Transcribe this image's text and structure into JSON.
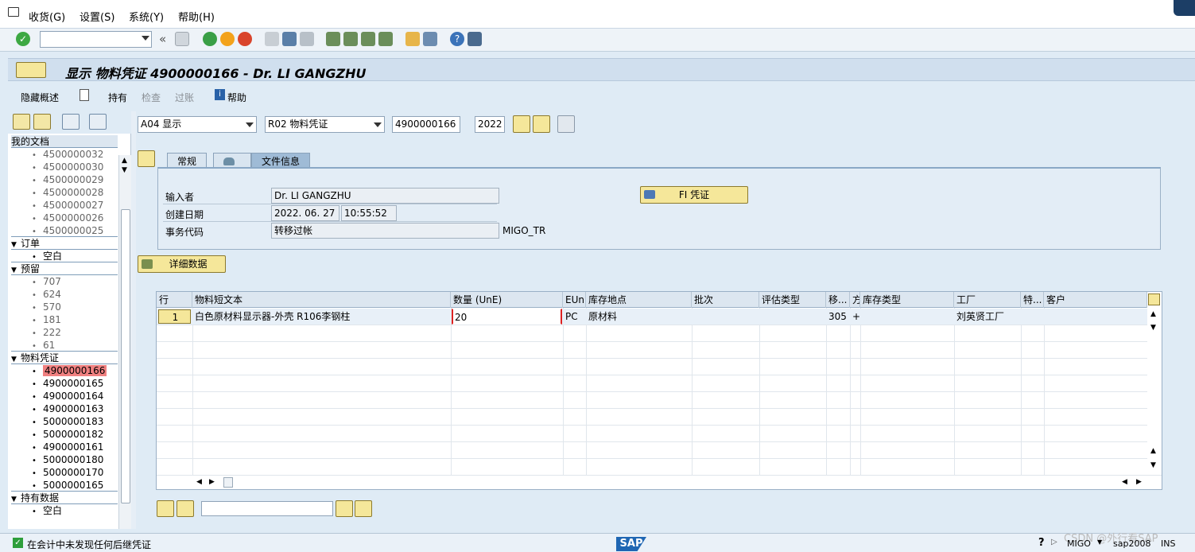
{
  "menu": {
    "items": [
      "收货(G)",
      "设置(S)",
      "系统(Y)",
      "帮助(H)"
    ]
  },
  "toolbar": {
    "command_value": "",
    "back_label": "«"
  },
  "title": "显示 物料凭证 4900000166 - Dr. LI GANGZHU",
  "appbar": {
    "hide_overview": "隐藏概述",
    "hold": "持有",
    "check": "检查",
    "post": "过账",
    "help": "帮助"
  },
  "tree": {
    "header": "我的文档",
    "my_docs": [
      "4500000032",
      "4500000030",
      "4500000029",
      "4500000028",
      "4500000027",
      "4500000026",
      "4500000025"
    ],
    "orders_label": "订单",
    "orders": [
      "空白"
    ],
    "reservations_label": "预留",
    "reservations": [
      "707",
      "624",
      "570",
      "181",
      "222",
      "61"
    ],
    "matdocs_label": "物料凭证",
    "matdocs": [
      "4900000166",
      "4900000165",
      "4900000164",
      "4900000163",
      "5000000183",
      "5000000182",
      "4900000161",
      "5000000180",
      "5000000170",
      "5000000165"
    ],
    "held_label": "持有数据",
    "held": [
      "空白"
    ]
  },
  "header_fields": {
    "action": "A04 显示",
    "ref": "R02 物料凭证",
    "doc_no": "4900000166",
    "year": "2022"
  },
  "tabs": [
    "常规",
    "",
    "文件信息"
  ],
  "docinfo": {
    "entered_by_label": "输入者",
    "entered_by": "Dr. LI GANGZHU",
    "created_label": "创建日期",
    "created_date": "2022. 06. 27",
    "created_time": "10:55:52",
    "tcode_label": "事务代码",
    "tcode": "转移过帐",
    "tcode_code": "MIGO_TR",
    "fi_button": "FI 凭证"
  },
  "detail_button": "详细数据",
  "grid": {
    "columns": [
      "行",
      "物料短文本",
      "数量 (UnE)",
      "EUn",
      "库存地点",
      "批次",
      "评估类型",
      "移...",
      "方",
      "库存类型",
      "工厂",
      "特...",
      "客户"
    ],
    "rows": [
      {
        "line": "1",
        "text": "白色原材料显示器-外壳 R106李钢柱",
        "qty": "20",
        "eun": "PC",
        "sloc": "原材料",
        "batch": "",
        "val": "",
        "mvt": "305",
        "dir": "+",
        "stype": "",
        "plant": "刘英贤工厂",
        "spec": "",
        "cust": ""
      }
    ]
  },
  "status": {
    "message": "在会计中未发现任何后继凭证",
    "sap": "SAP",
    "watermark": "CSDN @外行看SAP",
    "tcode": "MIGO",
    "server": "sap2008",
    "mode": "INS"
  },
  "colors": {
    "accent": "#f5e79a",
    "selection": "#f08080",
    "panel": "#e3edf6"
  }
}
